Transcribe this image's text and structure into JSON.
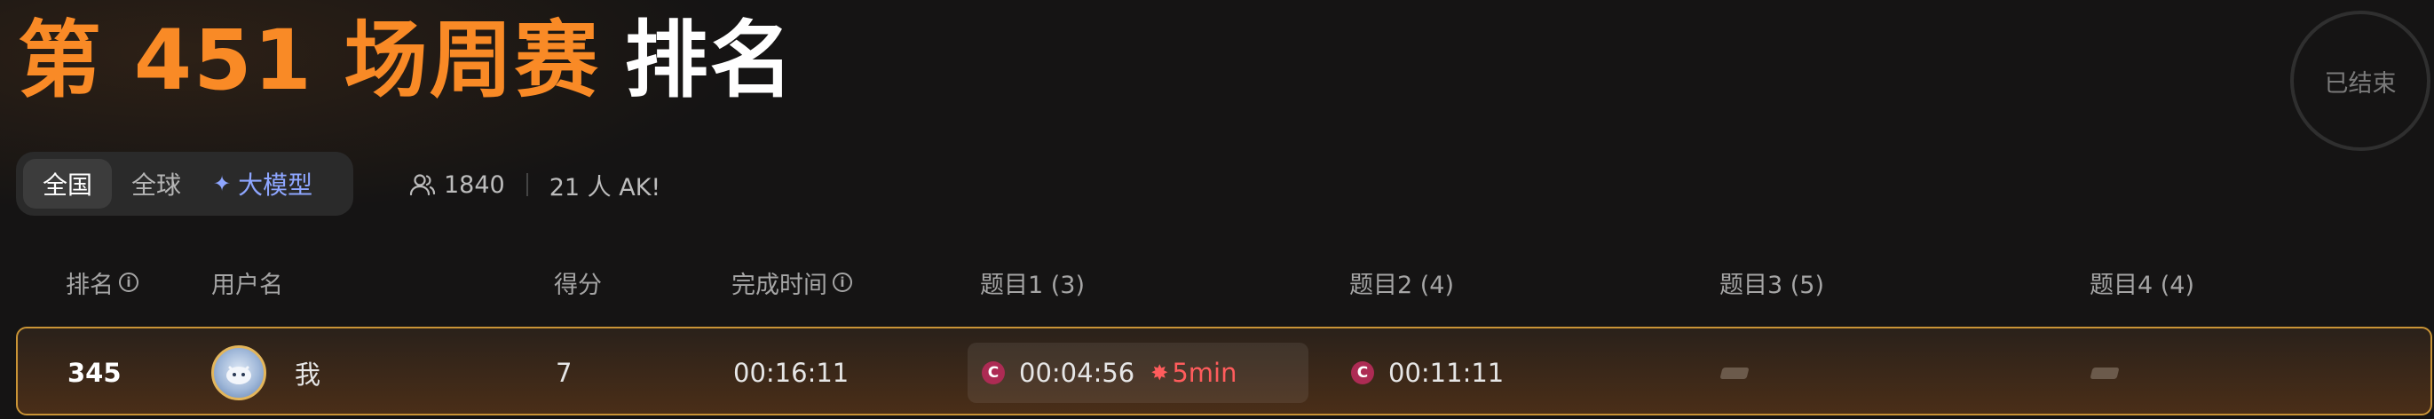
{
  "header": {
    "title_accent": "第 451 场周赛",
    "title_rest": "排名",
    "status": "已结束"
  },
  "tabs": [
    {
      "label": "全国",
      "active": true
    },
    {
      "label": "全球",
      "active": false
    },
    {
      "label": "大模型",
      "active": false,
      "icon": "sparkle-icon"
    }
  ],
  "stats": {
    "participants": "1840",
    "ak": "21 人 AK!"
  },
  "columns": {
    "rank": "排名",
    "username": "用户名",
    "score": "得分",
    "finish_time": "完成时间",
    "problems": [
      "题目1 (3)",
      "题目2 (4)",
      "题目3 (5)",
      "题目4 (4)"
    ]
  },
  "my_row": {
    "rank": "345",
    "name": "我",
    "score": "7",
    "finish_time": "00:16:11",
    "p1_time": "00:04:56",
    "p1_penalty": "5min",
    "p2_time": "00:11:11"
  },
  "colors": {
    "accent": "#f98a26",
    "penalty": "#ff5c5c",
    "ai_tab": "#8ea6ff",
    "row_border": "#c99436"
  }
}
